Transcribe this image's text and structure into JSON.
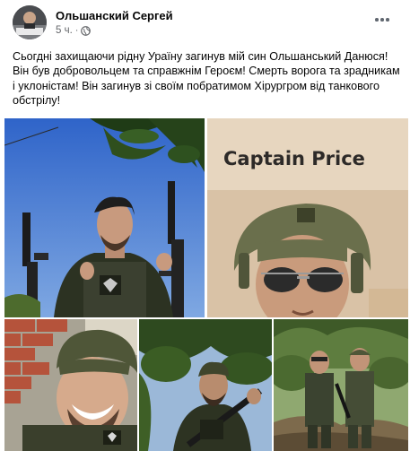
{
  "post": {
    "author": "Ольшанский Сергей",
    "time": "5 ч.",
    "separator": "·",
    "privacy_icon": "globe-icon",
    "more_icon": "more-options-icon",
    "text": "Сьогдні захищаючи рідну Ураїну загинув мій син Ольшанський Данюся!  Він був добровольцем та справжнім Героєм! Смерть ворога та зрадникам і уклоністам! Він загинув зі своїм побратимом Хірургром від танкового обстрілу!"
  },
  "photos": {
    "photo_2_caption": "Captain Price"
  },
  "colors": {
    "name": "#050505",
    "meta": "#65676b"
  }
}
